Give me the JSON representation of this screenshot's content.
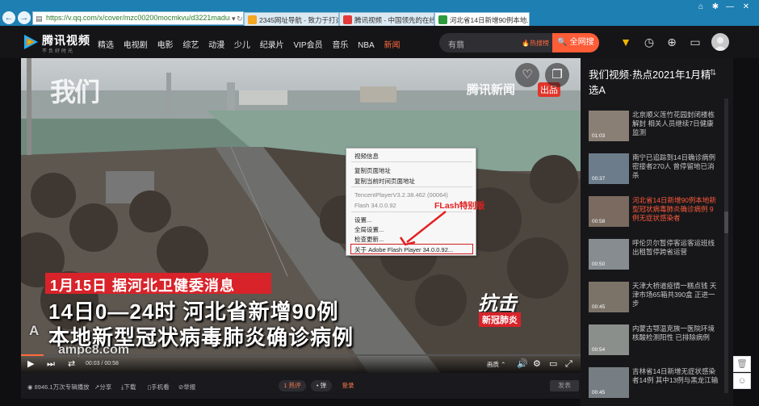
{
  "browser": {
    "address": "https://v.qq.com/x/cover/mzc00200mocmkvu/d3221maduny.h",
    "tabs": [
      {
        "label": "2345网址导航 - 致力于打造百...",
        "color": "#f5a623"
      },
      {
        "label": "腾讯视频 - 中国领先的在线视...",
        "color": "#e23a3a"
      },
      {
        "label": "河北省14日新增90例本地...",
        "color": "#2e9a3e"
      }
    ],
    "window_controls": [
      "⌂",
      "✱",
      "—",
      "✕"
    ]
  },
  "header": {
    "brand": "腾讯视频",
    "slogan": "不负好时光",
    "nav": [
      "精选",
      "电视剧",
      "电影",
      "综艺",
      "动漫",
      "少儿",
      "纪录片",
      "VIP会员",
      "音乐",
      "NBA",
      "新闻"
    ],
    "search_placeholder": "有翡",
    "hot_search": "热搜榜",
    "search_button": "全网搜"
  },
  "player": {
    "watermark_left": "我们",
    "watermark_right": "腾讯新闻",
    "watermark_tag": "出品",
    "caption_date": "1月15日  据河北卫健委消息",
    "caption_line1": "14日0—24时 河北省新增90例",
    "caption_line2": "本地新型冠状病毒肺炎确诊病例",
    "stamp_big": "抗击",
    "stamp_small": "新冠肺炎",
    "site_watermark_1": "A  ",
    "site_watermark_2": "ampc8.com",
    "time": "00:03 / 00:58",
    "quality": "画质",
    "progress": 0.04,
    "flash_label": "FLash特别版",
    "context_menu": {
      "video_info": "视频信息",
      "copy_url": "复制页面地址",
      "copy_time_url": "复制当前时间页面地址",
      "player_version": "TencentPlayerV3.2.38.462 (00064)",
      "flash_version": "Flash 34.0.0.92",
      "settings": "设置...",
      "global_settings": "全局设置...",
      "check_update": "检查更新...",
      "about": "关于 Adobe Flash Player 34.0.0.92..."
    }
  },
  "bottom_bar": {
    "views": "8946.1万次专辑播放",
    "share": "分享",
    "download": "下载",
    "phone": "手机看",
    "report": "举报",
    "danmu_count": "1 热评",
    "danmu": "• 弹",
    "login": "登录",
    "send": "发表"
  },
  "sidebar": {
    "title": "我们视频·热点2021年1月精选A",
    "items": [
      {
        "duration": "01:03",
        "title": "北京顺义莲竹花园封闭楼栋解封 相关人员继续7日健康监测",
        "highlight": false
      },
      {
        "duration": "00:37",
        "title": "南宁已追踪到14日确诊病例密接者270人 曾停留地已消杀",
        "highlight": false
      },
      {
        "duration": "00:58",
        "title": "河北省14日新增90例本地新型冠状病毒肺炎确诊病例 9例无症状感染者",
        "highlight": true
      },
      {
        "duration": "00:50",
        "title": "呼伦贝尔暂停客运客运班线 出租暂停跨省运营",
        "highlight": false
      },
      {
        "duration": "00:45",
        "title": "天津大桥道疫情一糕点钱 天津市场65箱共390盒 正进一步",
        "highlight": false
      },
      {
        "duration": "00:54",
        "title": "内蒙古鄂温克族一医院环境核酸检测阳性 已排除病例",
        "highlight": false
      },
      {
        "duration": "00:45",
        "title": "吉林省14日新增无症状感染者14例 其中13例与黑龙江输",
        "highlight": false
      }
    ]
  }
}
